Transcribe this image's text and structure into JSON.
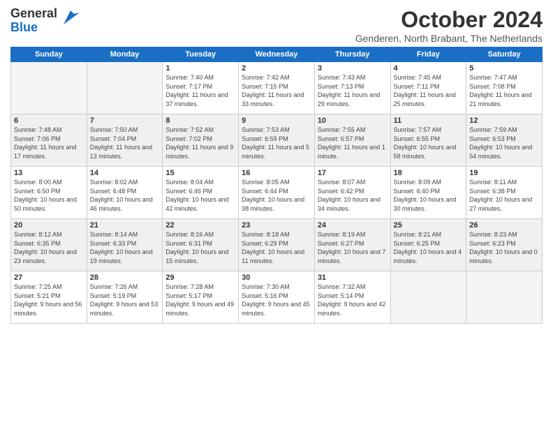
{
  "header": {
    "logo_line1": "General",
    "logo_line2": "Blue",
    "month_title": "October 2024",
    "subtitle": "Genderen, North Brabant, The Netherlands"
  },
  "weekdays": [
    "Sunday",
    "Monday",
    "Tuesday",
    "Wednesday",
    "Thursday",
    "Friday",
    "Saturday"
  ],
  "weeks": [
    [
      {
        "day": "",
        "info": ""
      },
      {
        "day": "",
        "info": ""
      },
      {
        "day": "1",
        "info": "Sunrise: 7:40 AM\nSunset: 7:17 PM\nDaylight: 11 hours and 37 minutes."
      },
      {
        "day": "2",
        "info": "Sunrise: 7:42 AM\nSunset: 7:15 PM\nDaylight: 11 hours and 33 minutes."
      },
      {
        "day": "3",
        "info": "Sunrise: 7:43 AM\nSunset: 7:13 PM\nDaylight: 11 hours and 29 minutes."
      },
      {
        "day": "4",
        "info": "Sunrise: 7:45 AM\nSunset: 7:11 PM\nDaylight: 11 hours and 25 minutes."
      },
      {
        "day": "5",
        "info": "Sunrise: 7:47 AM\nSunset: 7:08 PM\nDaylight: 11 hours and 21 minutes."
      }
    ],
    [
      {
        "day": "6",
        "info": "Sunrise: 7:48 AM\nSunset: 7:06 PM\nDaylight: 11 hours and 17 minutes."
      },
      {
        "day": "7",
        "info": "Sunrise: 7:50 AM\nSunset: 7:04 PM\nDaylight: 11 hours and 13 minutes."
      },
      {
        "day": "8",
        "info": "Sunrise: 7:52 AM\nSunset: 7:02 PM\nDaylight: 11 hours and 9 minutes."
      },
      {
        "day": "9",
        "info": "Sunrise: 7:53 AM\nSunset: 6:59 PM\nDaylight: 11 hours and 5 minutes."
      },
      {
        "day": "10",
        "info": "Sunrise: 7:55 AM\nSunset: 6:57 PM\nDaylight: 11 hours and 1 minute."
      },
      {
        "day": "11",
        "info": "Sunrise: 7:57 AM\nSunset: 6:55 PM\nDaylight: 10 hours and 58 minutes."
      },
      {
        "day": "12",
        "info": "Sunrise: 7:59 AM\nSunset: 6:53 PM\nDaylight: 10 hours and 54 minutes."
      }
    ],
    [
      {
        "day": "13",
        "info": "Sunrise: 8:00 AM\nSunset: 6:50 PM\nDaylight: 10 hours and 50 minutes."
      },
      {
        "day": "14",
        "info": "Sunrise: 8:02 AM\nSunset: 6:48 PM\nDaylight: 10 hours and 46 minutes."
      },
      {
        "day": "15",
        "info": "Sunrise: 8:04 AM\nSunset: 6:46 PM\nDaylight: 10 hours and 42 minutes."
      },
      {
        "day": "16",
        "info": "Sunrise: 8:05 AM\nSunset: 6:44 PM\nDaylight: 10 hours and 38 minutes."
      },
      {
        "day": "17",
        "info": "Sunrise: 8:07 AM\nSunset: 6:42 PM\nDaylight: 10 hours and 34 minutes."
      },
      {
        "day": "18",
        "info": "Sunrise: 8:09 AM\nSunset: 6:40 PM\nDaylight: 10 hours and 30 minutes."
      },
      {
        "day": "19",
        "info": "Sunrise: 8:11 AM\nSunset: 6:38 PM\nDaylight: 10 hours and 27 minutes."
      }
    ],
    [
      {
        "day": "20",
        "info": "Sunrise: 8:12 AM\nSunset: 6:35 PM\nDaylight: 10 hours and 23 minutes."
      },
      {
        "day": "21",
        "info": "Sunrise: 8:14 AM\nSunset: 6:33 PM\nDaylight: 10 hours and 19 minutes."
      },
      {
        "day": "22",
        "info": "Sunrise: 8:16 AM\nSunset: 6:31 PM\nDaylight: 10 hours and 15 minutes."
      },
      {
        "day": "23",
        "info": "Sunrise: 8:18 AM\nSunset: 6:29 PM\nDaylight: 10 hours and 11 minutes."
      },
      {
        "day": "24",
        "info": "Sunrise: 8:19 AM\nSunset: 6:27 PM\nDaylight: 10 hours and 7 minutes."
      },
      {
        "day": "25",
        "info": "Sunrise: 8:21 AM\nSunset: 6:25 PM\nDaylight: 10 hours and 4 minutes."
      },
      {
        "day": "26",
        "info": "Sunrise: 8:23 AM\nSunset: 6:23 PM\nDaylight: 10 hours and 0 minutes."
      }
    ],
    [
      {
        "day": "27",
        "info": "Sunrise: 7:25 AM\nSunset: 5:21 PM\nDaylight: 9 hours and 56 minutes."
      },
      {
        "day": "28",
        "info": "Sunrise: 7:26 AM\nSunset: 5:19 PM\nDaylight: 9 hours and 53 minutes."
      },
      {
        "day": "29",
        "info": "Sunrise: 7:28 AM\nSunset: 5:17 PM\nDaylight: 9 hours and 49 minutes."
      },
      {
        "day": "30",
        "info": "Sunrise: 7:30 AM\nSunset: 5:16 PM\nDaylight: 9 hours and 45 minutes."
      },
      {
        "day": "31",
        "info": "Sunrise: 7:32 AM\nSunset: 5:14 PM\nDaylight: 9 hours and 42 minutes."
      },
      {
        "day": "",
        "info": ""
      },
      {
        "day": "",
        "info": ""
      }
    ]
  ]
}
